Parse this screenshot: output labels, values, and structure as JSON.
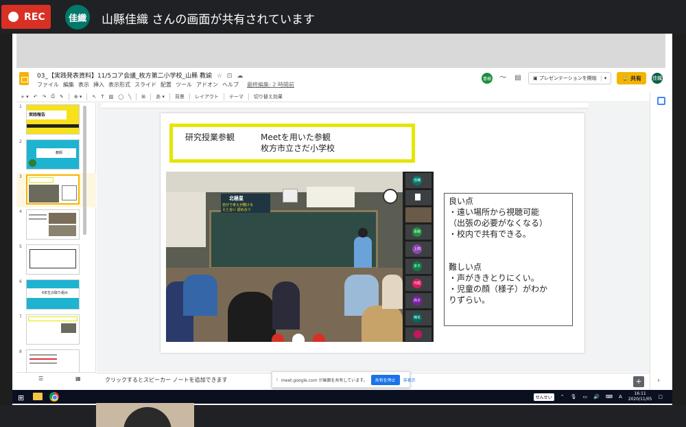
{
  "meet": {
    "rec_label": "REC",
    "sharer_avatar": "佳織",
    "share_message": "山縣佳織 さんの画面が共有されています"
  },
  "slides_app": {
    "title": "03_【実践発表資料】11/5コア会議_枚方第二小学校_山縣 教諭",
    "menu": [
      "ファイル",
      "編集",
      "表示",
      "挿入",
      "表示形式",
      "スライド",
      "配置",
      "ツール",
      "アドオン",
      "ヘルプ"
    ],
    "last_edit": "最終編集: 2 時間前",
    "collab_avatar": "青柳",
    "present_label": "プレゼンテーションを開始",
    "share_label": "共有",
    "user_avatar": "佳織",
    "toolbar": {
      "background": "背景",
      "layout": "レイアウト",
      "theme": "テーマ",
      "transition": "切り替え効果"
    },
    "speaker_notes_placeholder": "クリックするとスピーカー ノートを追加できます"
  },
  "filmstrip": {
    "slides": [
      {
        "num": "1",
        "caption": "実践報告"
      },
      {
        "num": "2",
        "caption": "教師"
      },
      {
        "num": "3",
        "caption": ""
      },
      {
        "num": "4",
        "caption": ""
      },
      {
        "num": "5",
        "caption": ""
      },
      {
        "num": "6",
        "caption": "6年生の取り組み"
      },
      {
        "num": "7",
        "caption": ""
      },
      {
        "num": "8",
        "caption": ""
      }
    ],
    "active_index": 2
  },
  "slide": {
    "box_label": "研究授業参観",
    "box_line1": "Meetを用いた参観",
    "box_line2": "枚方市立さだ小学校",
    "good_title": "良い点",
    "good_1": "・遠い場所から視聴可能",
    "good_2": "（出張の必要がなくなる）",
    "good_3": "・校内で共有できる。",
    "bad_title": "難しい点",
    "bad_1": "・声がききとりにくい。",
    "bad_2": "・児童の顔（様子）がわか",
    "bad_3": "りずらい。",
    "blackboard_title": "北極星",
    "blackboard_line1": "自分で考えが動ける",
    "blackboard_line2": "えと合い 認め合う",
    "participant_tiles": [
      "佳織",
      "",
      "",
      "青柳",
      "上田",
      "京子",
      "元昭",
      "尚子",
      "楠花",
      ""
    ]
  },
  "meet_share_bar": {
    "text": "meet.google.com が画面を共有しています。",
    "stop_label": "共有を停止",
    "hide_label": "非表示"
  },
  "taskbar": {
    "ime": "せんせい",
    "ime_mode": "A",
    "time": "16:11",
    "date": "2020/11/05"
  },
  "colors": {
    "rec_red": "#d93025",
    "slides_yellow": "#f4b400",
    "highlight_box": "#e5e500",
    "meet_stop_blue": "#1a73e8"
  }
}
